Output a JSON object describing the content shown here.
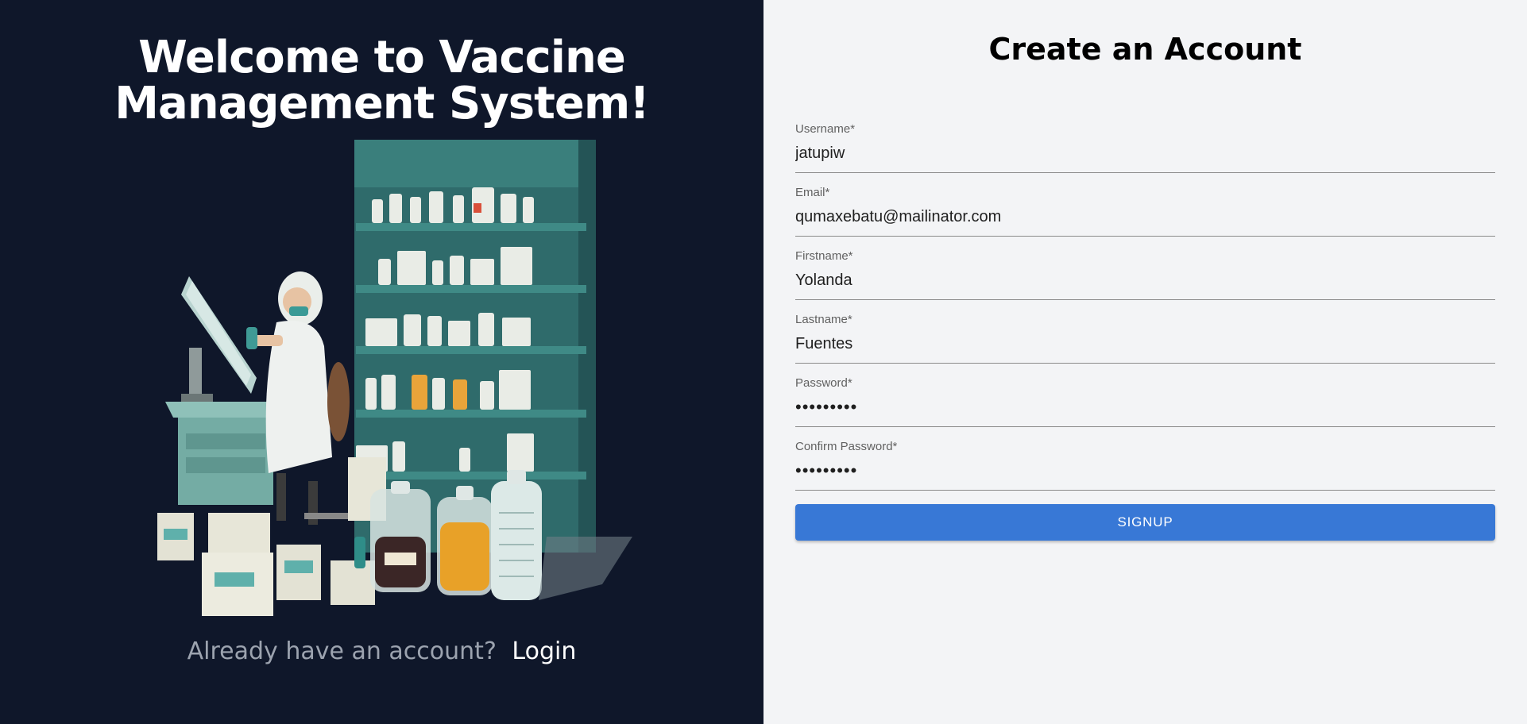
{
  "welcome": {
    "line1": "Welcome to Vaccine",
    "line2": "Management System!"
  },
  "illustration_icon": "pharmacist-lab-illustration",
  "account_prompt": {
    "question": "Already have an account?",
    "login_label": "Login"
  },
  "form": {
    "title": "Create an Account",
    "fields": [
      {
        "label": "Username*",
        "value": "jatupiw",
        "type": "text"
      },
      {
        "label": "Email*",
        "value": "qumaxebatu@mailinator.com",
        "type": "email"
      },
      {
        "label": "Firstname*",
        "value": "Yolanda",
        "type": "text"
      },
      {
        "label": "Lastname*",
        "value": "Fuentes",
        "type": "text"
      },
      {
        "label": "Password*",
        "value": "123456789",
        "type": "password"
      },
      {
        "label": "Confirm Password*",
        "value": "123456789",
        "type": "password"
      }
    ],
    "submit_label": "SIGNUP"
  },
  "colors": {
    "left_bg": "#0f172a",
    "right_bg": "#f3f4f6",
    "button_bg": "#3878d6"
  }
}
